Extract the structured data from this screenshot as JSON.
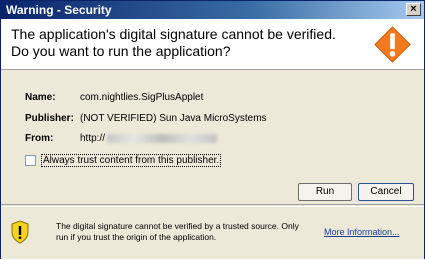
{
  "window": {
    "title": "Warning - Security",
    "close_label": "×"
  },
  "header": {
    "line1": "The application's digital signature cannot be verified.",
    "line2": "Do you want to run the application?",
    "icon": "warning-diamond-icon"
  },
  "info": {
    "name_label": "Name:",
    "name_value": "com.nightlies.SigPlusApplet",
    "publisher_label": "Publisher:",
    "publisher_value": "(NOT VERIFIED) Sun Java MicroSystems",
    "from_label": "From:",
    "from_value": "http://"
  },
  "trust": {
    "label": "Always trust content from this publisher.",
    "checked": false
  },
  "buttons": {
    "run": "Run",
    "cancel": "Cancel"
  },
  "footer": {
    "icon": "shield-warning-icon",
    "message": "The digital signature cannot be verified by a trusted source.  Only run if you trust the origin of the application.",
    "link": "More Information..."
  },
  "colors": {
    "titlebar": "#0a246a",
    "warning_orange": "#f37a1f",
    "shield_yellow": "#f4d21d",
    "link": "#1a3f8f"
  }
}
